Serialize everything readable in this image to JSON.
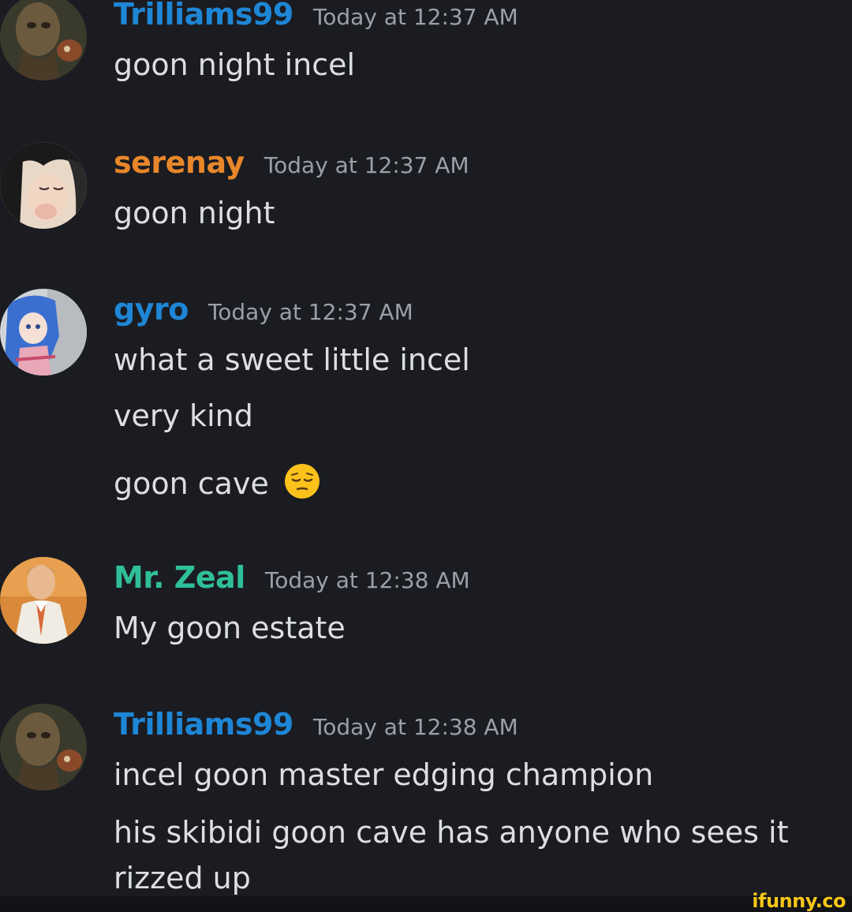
{
  "messages": [
    {
      "username": "Trilliams99",
      "username_color": "#1e86d6",
      "timestamp": "Today at 12:37 AM",
      "avatar": "painting-avatar",
      "lines": [
        "goon night incel"
      ]
    },
    {
      "username": "serenay",
      "username_color": "#e8862a",
      "timestamp": "Today at 12:37 AM",
      "avatar": "anime-girl-avatar",
      "lines": [
        "goon night"
      ]
    },
    {
      "username": "gyro",
      "username_color": "#1e86d6",
      "timestamp": "Today at 12:37 AM",
      "avatar": "blue-hair-anime-avatar",
      "lines": [
        "what a sweet little incel",
        "very kind",
        "goon cave"
      ]
    },
    {
      "username": "Mr. Zeal",
      "username_color": "#2fbf9a",
      "timestamp": "Today at 12:38 AM",
      "avatar": "white-suit-man-avatar",
      "lines": [
        "My goon estate"
      ]
    },
    {
      "username": "Trilliams99",
      "username_color": "#1e86d6",
      "timestamp": "Today at 12:38 AM",
      "avatar": "painting-avatar",
      "lines": [
        "incel goon master edging champion",
        "his skibidi goon cave has anyone who sees it rizzed up"
      ]
    }
  ],
  "emoji": "pensive-face-emoji",
  "watermark": "ifunny.co"
}
